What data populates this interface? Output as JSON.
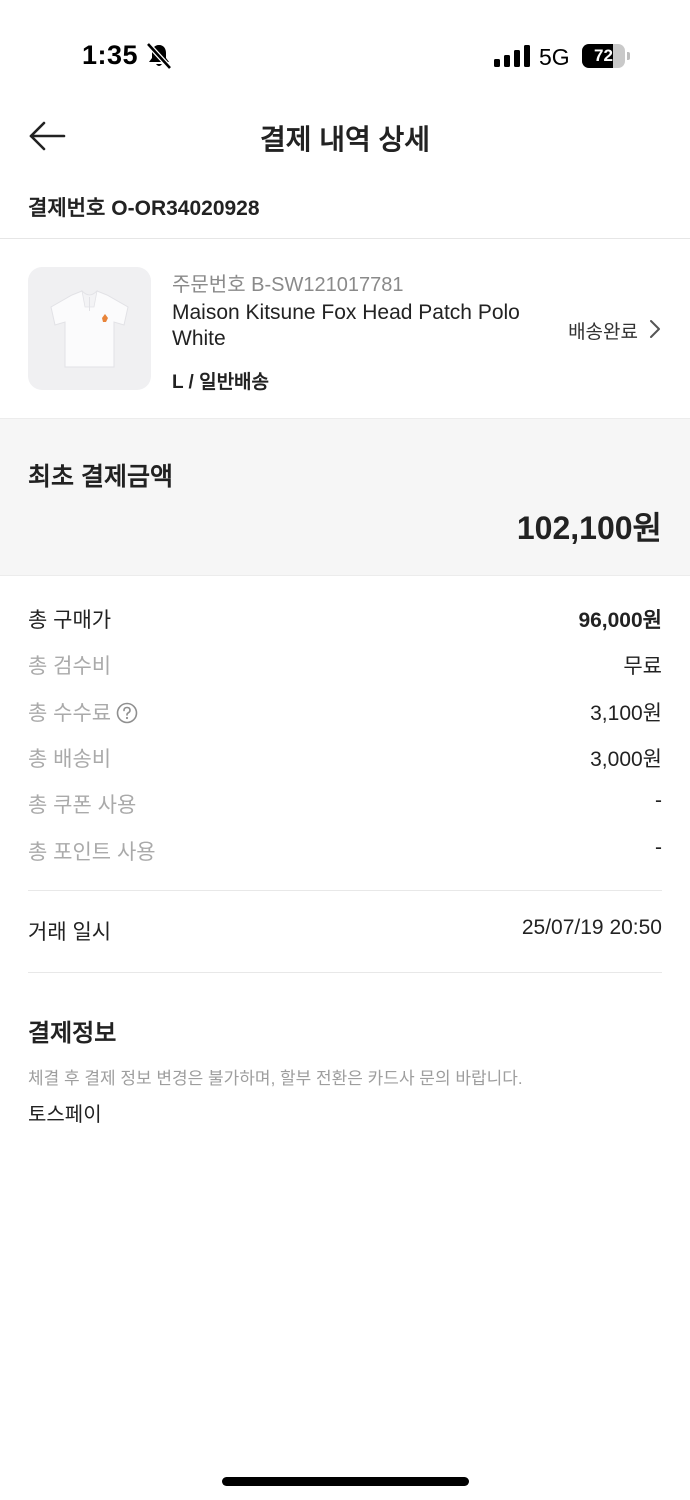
{
  "status_bar": {
    "time": "1:35",
    "network": "5G",
    "battery": "72",
    "battery_level": 0.72
  },
  "header": {
    "title": "결제 내역 상세",
    "back_icon": "arrow-left-icon"
  },
  "payment": {
    "label": "결제번호",
    "number": "O-OR34020928"
  },
  "product": {
    "order_number": "주문번호 B-SW121017781",
    "name": "Maison Kitsune Fox Head Patch Polo White",
    "option": "L / 일반배송",
    "status": "배송완료",
    "image_icon": "polo-shirt-icon"
  },
  "initial_payment": {
    "label": "최초 결제금액",
    "amount": "102,100원"
  },
  "breakdown": [
    {
      "label": "총 구매가",
      "value": "96,000원"
    },
    {
      "label": "총 검수비",
      "value": "무료"
    },
    {
      "label": "총 수수료",
      "value": "3,100원"
    },
    {
      "label": "총 배송비",
      "value": "3,000원"
    },
    {
      "label": "총 쿠폰 사용",
      "value": "-"
    },
    {
      "label": "총 포인트 사용",
      "value": "-"
    }
  ],
  "transaction": {
    "label": "거래 일시",
    "value": "25/07/19 20:50"
  },
  "payment_info": {
    "title": "결제정보",
    "notice": "체결 후 결제 정보 변경은 불가하며, 할부 전환은 카드사 문의 바랍니다.",
    "method": "토스페이"
  }
}
